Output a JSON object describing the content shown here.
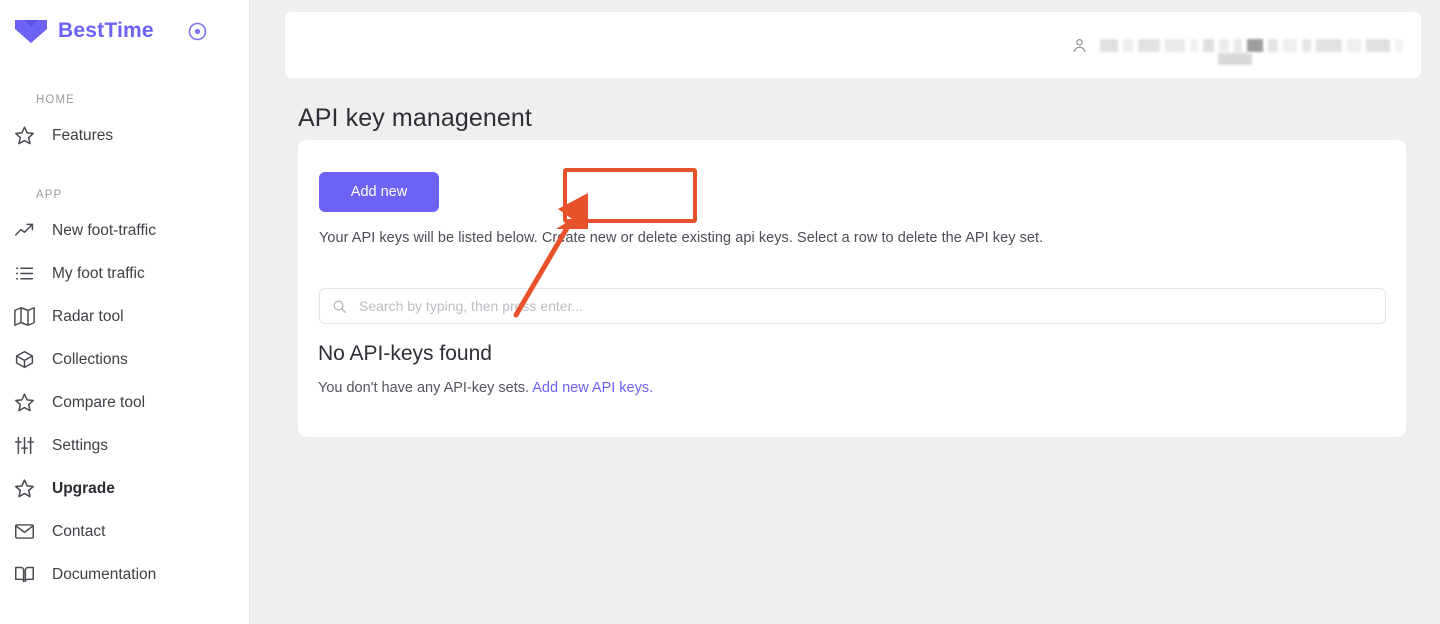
{
  "sidebar": {
    "brand": {
      "name": "BestTime",
      "logo_icon": "heart-logo-icon",
      "target_icon": "target-icon",
      "accent_color": "#6c63f5"
    },
    "sections": [
      {
        "label": "HOME",
        "items": [
          {
            "label": "Features",
            "icon": "star-icon",
            "bold": false
          }
        ]
      },
      {
        "label": "APP",
        "items": [
          {
            "label": "New foot-traffic",
            "icon": "trending-up-icon",
            "bold": false
          },
          {
            "label": "My foot traffic",
            "icon": "list-icon",
            "bold": false
          },
          {
            "label": "Radar tool",
            "icon": "map-icon",
            "bold": false
          },
          {
            "label": "Collections",
            "icon": "package-icon",
            "bold": false
          },
          {
            "label": "Compare tool",
            "icon": "star-icon",
            "bold": false
          },
          {
            "label": "Settings",
            "icon": "sliders-icon",
            "bold": false
          },
          {
            "label": "Upgrade",
            "icon": "star-icon",
            "bold": true
          },
          {
            "label": "Contact",
            "icon": "mail-icon",
            "bold": false
          },
          {
            "label": "Documentation",
            "icon": "book-icon",
            "bold": false
          }
        ]
      }
    ]
  },
  "topbar": {
    "user_icon": "person-icon",
    "account_text_redacted": true
  },
  "main": {
    "page_title": "API key managenent",
    "card": {
      "add_new_label": "Add new",
      "description": "Your API keys will be listed below. Create new or delete existing api keys. Select a row to delete the API key set.",
      "search": {
        "placeholder": "Search by typing, then press enter...",
        "value": "",
        "icon": "search-icon"
      },
      "empty_state": {
        "title": "No API-keys found",
        "text": "You don't have any API-key sets.",
        "link_label": "Add new API keys."
      }
    }
  },
  "annotation": {
    "highlight_color": "#e8522b",
    "target_element": "Add new",
    "arrow_icon": "arrow-pointer-icon"
  },
  "colors": {
    "accent_purple": "#6c63f5",
    "page_background": "#efefef",
    "card_background": "#ffffff",
    "annotation_orange": "#e8522b"
  }
}
